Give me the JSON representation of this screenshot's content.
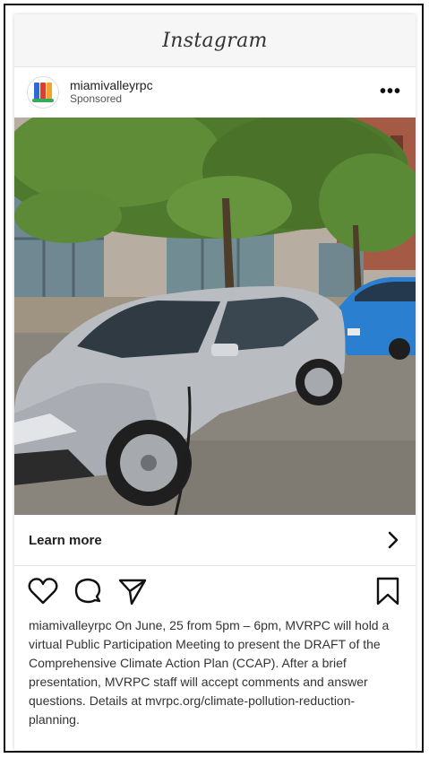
{
  "app": {
    "title": "Instagram"
  },
  "post": {
    "username": "miamivalleyrpc",
    "sponsored_label": "Sponsored",
    "more_label": "•••",
    "cta_label": "Learn more",
    "caption_user": "miamivalleyrpc",
    "caption_text": " On June, 25 from 5pm – 6pm, MVRPC will hold a virtual Public Participation Meeting to present the DRAFT of the Comprehensive Climate Action Plan (CCAP). After a brief presentation, MVRPC staff will accept comments and answer questions. Details at mvrpc.org/climate-pollution-reduction-planning."
  },
  "icons": {
    "heart": "heart-icon",
    "comment": "comment-icon",
    "share": "send-icon",
    "bookmark": "bookmark-icon",
    "chevron": "chevron-right-icon"
  },
  "colors": {
    "silver_car": "#b9bcc1",
    "blue_car": "#2a7fd0"
  }
}
